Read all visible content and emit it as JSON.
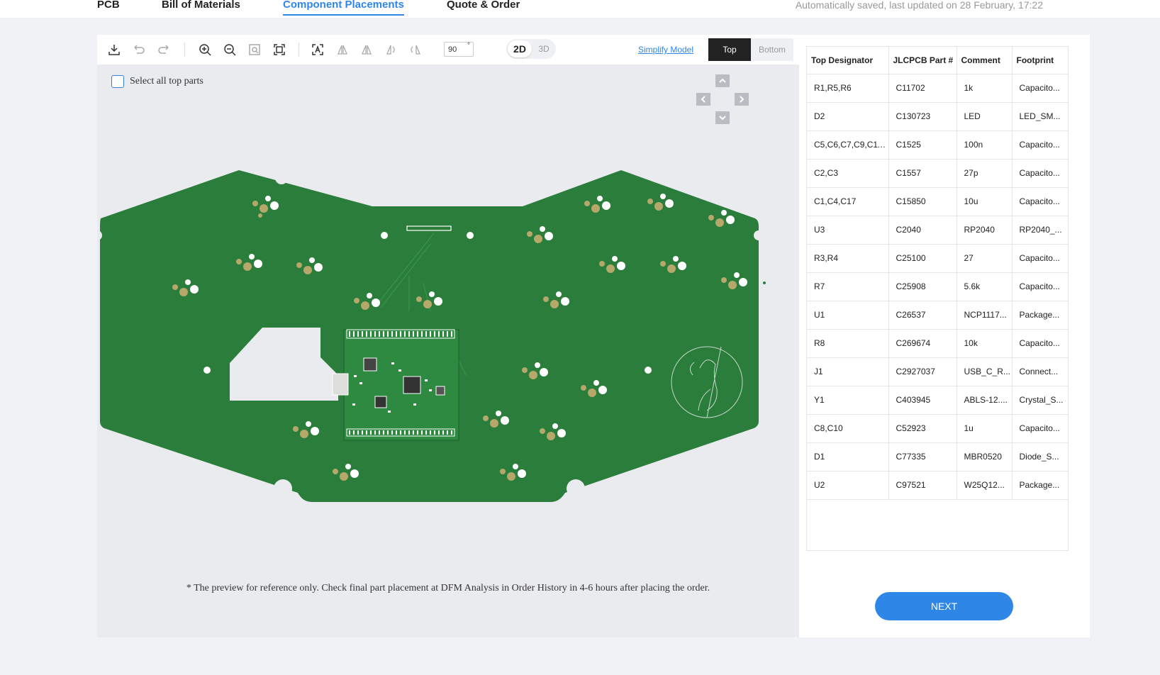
{
  "nav": {
    "tabs": [
      {
        "label": "PCB"
      },
      {
        "label": "Bill of Materials"
      },
      {
        "label": "Component Placements"
      },
      {
        "label": "Quote & Order"
      }
    ],
    "active_tab": "Component Placements",
    "autosave_text": "Automatically saved, last updated on 28 February, 17:22"
  },
  "toolbar": {
    "icons": [
      "download-icon",
      "undo-icon",
      "redo-icon",
      "zoom-in-icon",
      "zoom-out-icon",
      "zoom-area-icon",
      "fit-screen-icon",
      "text-toggle-icon",
      "flip-horizontal-icon",
      "flip-vertical-icon",
      "rotate-left-icon",
      "rotate-right-icon"
    ],
    "rotation_value": "90",
    "rotation_unit": "°",
    "mode_2d": "2D",
    "mode_3d": "3D",
    "active_mode": "2D",
    "simplify_model": "Simplify Model",
    "side_top": "Top",
    "side_bottom": "Bottom",
    "active_side": "Top"
  },
  "viewer": {
    "select_all_label": "Select all top parts",
    "select_all_checked": false,
    "footnote": "* The preview for reference only. Check final part placement at DFM Analysis in Order History in 4-6 hours after placing the order.",
    "pcb_color": "#2a7d3b"
  },
  "table": {
    "headers": [
      "Top Designator",
      "JLCPCB Part #",
      "Comment",
      "Footprint"
    ],
    "rows": [
      [
        "R1,R5,R6",
        "C11702",
        "1k",
        "Capacito..."
      ],
      [
        "D2",
        "C130723",
        "LED",
        "LED_SM..."
      ],
      [
        "C5,C6,C7,C9,C11...",
        "C1525",
        "100n",
        "Capacito..."
      ],
      [
        "C2,C3",
        "C1557",
        "27p",
        "Capacito..."
      ],
      [
        "C1,C4,C17",
        "C15850",
        "10u",
        "Capacito..."
      ],
      [
        "U3",
        "C2040",
        "RP2040",
        "RP2040_..."
      ],
      [
        "R3,R4",
        "C25100",
        "27",
        "Capacito..."
      ],
      [
        "R7",
        "C25908",
        "5.6k",
        "Capacito..."
      ],
      [
        "U1",
        "C26537",
        "NCP1117...",
        "Package..."
      ],
      [
        "R8",
        "C269674",
        "10k",
        "Capacito..."
      ],
      [
        "J1",
        "C2927037",
        "USB_C_R...",
        "Connect..."
      ],
      [
        "Y1",
        "C403945",
        "ABLS-12....",
        "Crystal_S..."
      ],
      [
        "C8,C10",
        "C52923",
        "1u",
        "Capacito..."
      ],
      [
        "D1",
        "C77335",
        "MBR0520",
        "Diode_S..."
      ],
      [
        "U2",
        "C97521",
        "W25Q12...",
        "Package..."
      ]
    ]
  },
  "next_button": "NEXT",
  "colors": {
    "accent": "#2e86e6",
    "pcb": "#2a7d3b",
    "pad": "#b5a86a"
  }
}
